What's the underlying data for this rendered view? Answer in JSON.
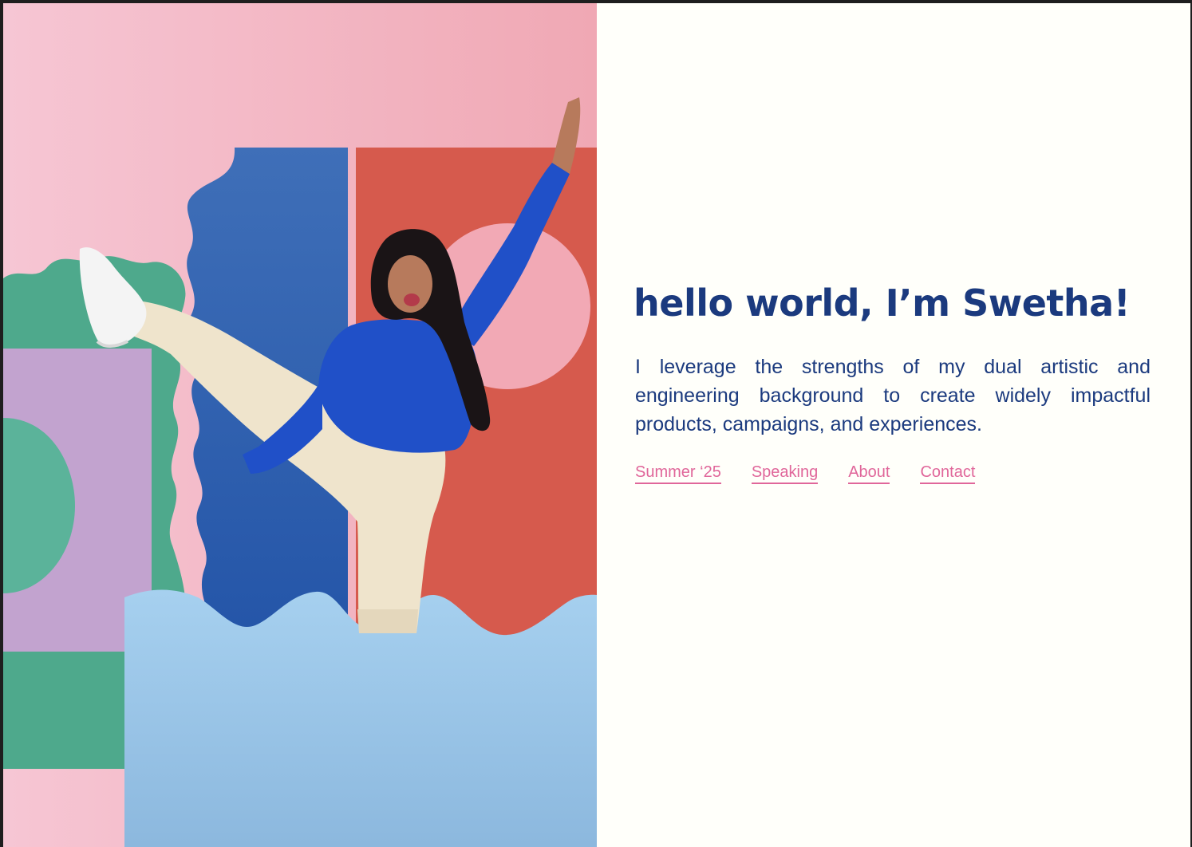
{
  "hero": {
    "title": "hello world, I’m Swetha!",
    "tagline": "I leverage the strengths of my dual artistic and engineering background to create widely impactful products, campaigns, and experiences."
  },
  "nav": {
    "items": [
      {
        "label": "Summer ‘25"
      },
      {
        "label": "Speaking"
      },
      {
        "label": "About"
      },
      {
        "label": "Contact"
      }
    ]
  },
  "colors": {
    "title": "#1b3a7e",
    "link": "#e0669a",
    "background": "#fffffa",
    "frame": "#1e1e1e"
  }
}
